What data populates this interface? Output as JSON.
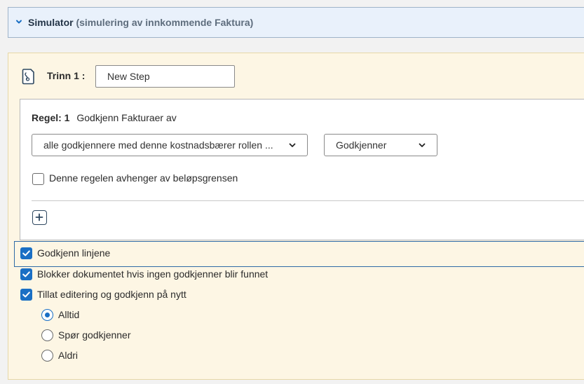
{
  "simulator": {
    "title": "Simulator",
    "subtitle": "(simulering av innkommende Faktura)"
  },
  "step": {
    "label": "Trinn 1 :",
    "name_value": "New Step"
  },
  "rule": {
    "number_label": "Regel: 1",
    "description": "Godkjenn Fakturaer av",
    "approver_select": "alle godkjennere med denne kostnadsbærer rollen ...",
    "role_select": "Godkjenner",
    "amount_limit_label": "Denne regelen avhenger av beløpsgrensen",
    "amount_limit_checked": false
  },
  "options": [
    {
      "label": "Godkjenn linjene",
      "checked": true
    },
    {
      "label": "Blokker dokumentet hvis ingen godkjenner blir funnet",
      "checked": true
    },
    {
      "label": "Tillat editering og godkjenn på nytt",
      "checked": true
    }
  ],
  "reapprove_mode": {
    "selected": "Alltid",
    "choices": [
      "Alltid",
      "Spør godkjenner",
      "Aldri"
    ]
  },
  "colors": {
    "accent": "#1a6fc4",
    "panel_bg": "#fdf6e4",
    "simulator_bg": "#e9f1fb"
  },
  "icons": {
    "collapse": "chevron-down-icon",
    "step": "document-icon",
    "add": "plus-icon"
  }
}
